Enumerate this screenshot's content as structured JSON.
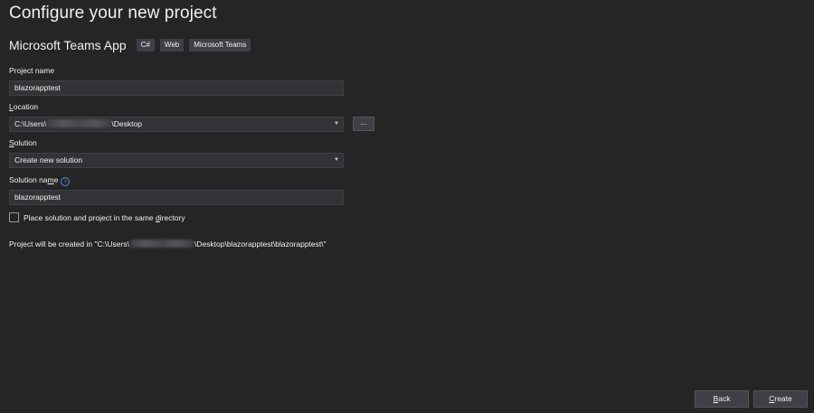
{
  "page_title": "Configure your new project",
  "template": {
    "name": "Microsoft Teams App",
    "tags": [
      "C#",
      "Web",
      "Microsoft Teams"
    ]
  },
  "project_name": {
    "label": "Project name",
    "value": "blazorapptest"
  },
  "location": {
    "label_accesskey": "L",
    "label_rest": "ocation",
    "value_prefix": "C:\\Users\\",
    "value_suffix": "\\Desktop",
    "browse_label": "..."
  },
  "solution": {
    "label_accesskey": "S",
    "label_rest": "olution",
    "value": "Create new solution"
  },
  "solution_name": {
    "label_start": "Solution na",
    "label_accesskey": "m",
    "label_end": "e",
    "value": "blazorapptest",
    "info_glyph": "i"
  },
  "same_directory": {
    "label_start": "Place solution and project in the same ",
    "label_accesskey": "d",
    "label_end": "irectory",
    "checked": false
  },
  "path_note": {
    "prefix": "Project will be created in \"C:\\Users\\",
    "suffix": "\\Desktop\\blazorapptest\\blazorapptest\\\""
  },
  "buttons": {
    "back_accesskey": "B",
    "back_rest": "ack",
    "create_accesskey": "C",
    "create_rest": "reate"
  },
  "icons": {
    "dropdown": "chevron-down-icon",
    "info": "info-icon"
  },
  "colors": {
    "background": "#252526",
    "field": "#333337",
    "accent": "#3794ff"
  }
}
